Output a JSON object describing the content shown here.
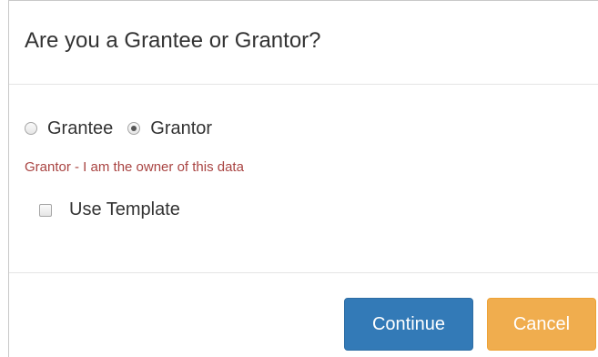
{
  "dialog": {
    "title": "Are you a Grantee or Grantor?"
  },
  "role_options": [
    {
      "label": "Grantee",
      "selected": false
    },
    {
      "label": "Grantor",
      "selected": true
    }
  ],
  "role_hint": "Grantor - I am the owner of this data",
  "use_template": {
    "label": "Use Template",
    "checked": false
  },
  "buttons": {
    "continue_label": "Continue",
    "cancel_label": "Cancel"
  },
  "colors": {
    "hint_text": "#a94442",
    "primary_button": "#337ab7",
    "warning_button": "#f0ad4e"
  }
}
